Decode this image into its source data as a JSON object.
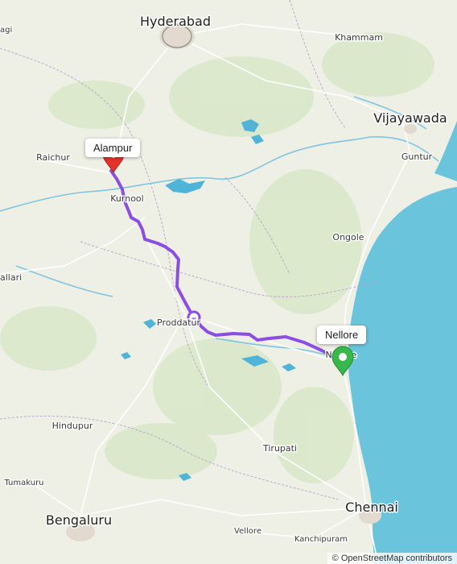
{
  "map": {
    "colors": {
      "land": "#eef0e6",
      "sea": "#6ac4dc",
      "water": "#4fb4d8",
      "route": "#8a4fe0",
      "start_marker": "#e5332a",
      "end_marker": "#38b84a"
    },
    "cities": {
      "hyderabad": "Hyderabad",
      "vijayawada": "Vijayawada",
      "bengaluru": "Bengaluru",
      "chennai": "Chennai",
      "khammam": "Khammam",
      "guntur": "Guntur",
      "raichur": "Raichur",
      "kurnool": "Kurnool",
      "ongole": "Ongole",
      "ballari": "allari",
      "proddatur": "Proddatur",
      "hindupur": "Hindupur",
      "tirupati": "Tirupati",
      "tumakuru": "Tumakuru",
      "vellore": "Vellore",
      "kanchipuram": "Kanchipuram",
      "nellore_city": "Nellore",
      "edge_left": "agi"
    },
    "markers": {
      "start_label": "Alampur",
      "end_label": "Nellore",
      "start_icon": "map-pin-red",
      "end_icon": "map-pin-green"
    },
    "attribution": "© OpenStreetMap contributors"
  }
}
